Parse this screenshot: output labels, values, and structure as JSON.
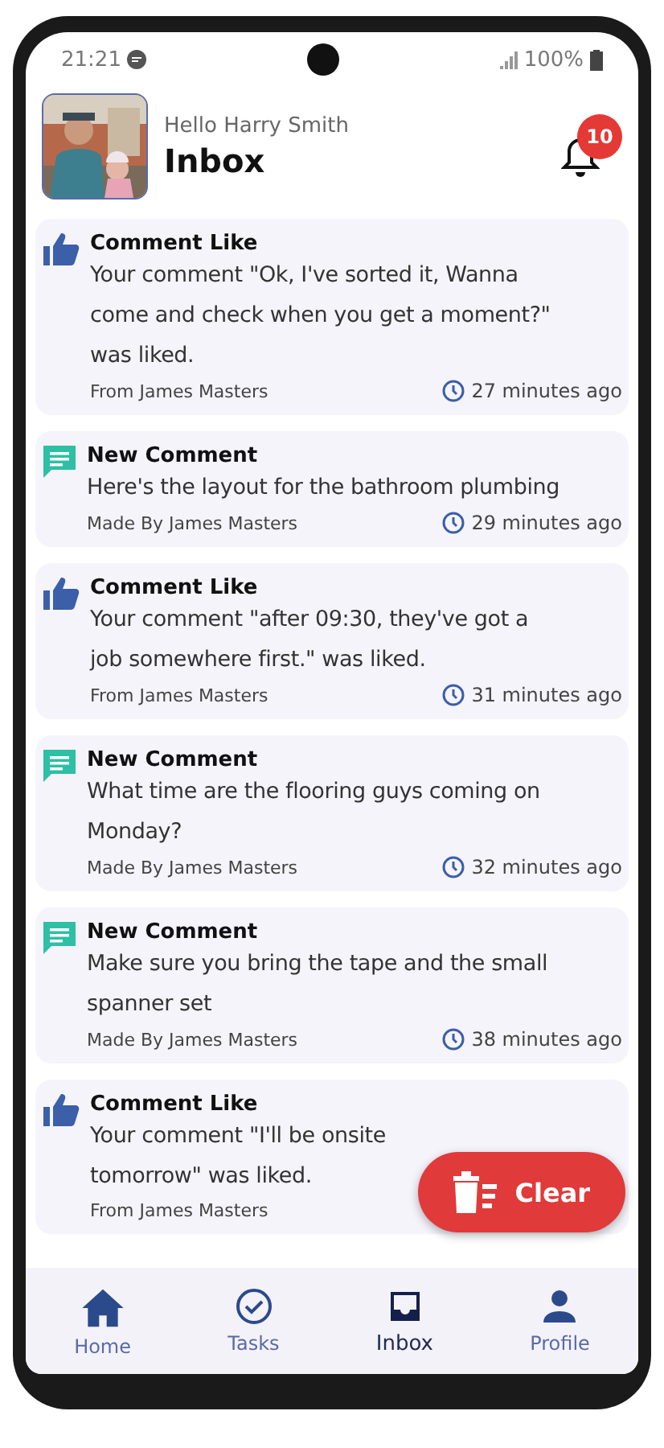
{
  "status_bar": {
    "time": "21:21",
    "battery": "100%"
  },
  "header": {
    "greeting": "Hello Harry Smith",
    "title": "Inbox",
    "notification_count": "10"
  },
  "notifications": [
    {
      "kind": "like",
      "title": "Comment Like",
      "lines": [
        "Your comment \"Ok, I've sorted it, Wanna",
        "come and check when you get a moment?\"",
        "was liked."
      ],
      "author": "From James Masters",
      "time": "27 minutes ago"
    },
    {
      "kind": "comment",
      "title": "New Comment",
      "lines": [
        "Here's the layout for the bathroom plumbing"
      ],
      "author": "Made By James Masters",
      "time": "29 minutes ago"
    },
    {
      "kind": "like",
      "title": "Comment Like",
      "lines": [
        "Your comment \"after 09:30, they've got a",
        "job somewhere first.\" was liked."
      ],
      "author": "From James Masters",
      "time": "31 minutes ago"
    },
    {
      "kind": "comment",
      "title": "New Comment",
      "lines": [
        "What time are the flooring guys coming on",
        "Monday?"
      ],
      "author": "Made By James Masters",
      "time": "32 minutes ago"
    },
    {
      "kind": "comment",
      "title": "New Comment",
      "lines": [
        "Make sure you bring the tape and the small",
        "spanner set"
      ],
      "author": "Made By James Masters",
      "time": "38 minutes ago"
    },
    {
      "kind": "like",
      "title": "Comment Like",
      "lines": [
        "Your comment \"I'll be onsite",
        "tomorrow\" was liked."
      ],
      "author": "From James Masters"
    }
  ],
  "clear_button": {
    "label": "Clear"
  },
  "nav": [
    {
      "label": "Home",
      "kind": "home",
      "selected": false
    },
    {
      "label": "Tasks",
      "kind": "tasks",
      "selected": false
    },
    {
      "label": "Inbox",
      "kind": "inbox",
      "selected": true
    },
    {
      "label": "Profile",
      "kind": "profile",
      "selected": false
    }
  ]
}
